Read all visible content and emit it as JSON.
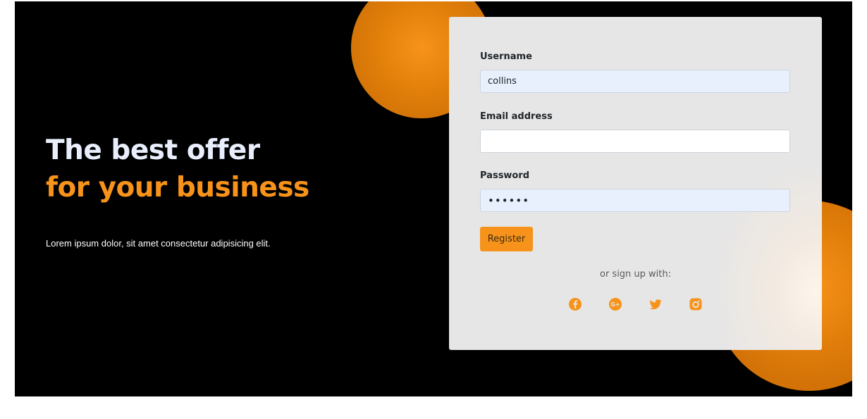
{
  "hero": {
    "headline_line1": "The best offer",
    "headline_line2": "for your business",
    "lede": "Lorem ipsum dolor, sit amet consectetur adipisicing elit."
  },
  "form": {
    "username": {
      "label": "Username",
      "value": "collins"
    },
    "email": {
      "label": "Email address",
      "value": ""
    },
    "password": {
      "label": "Password",
      "value": "••••••"
    },
    "register_label": "Register",
    "or_text": "or sign up with:",
    "socials": [
      {
        "name": "facebook-icon"
      },
      {
        "name": "google-plus-icon"
      },
      {
        "name": "twitter-icon"
      },
      {
        "name": "instagram-icon"
      }
    ]
  },
  "colors": {
    "accent": "#f7931a",
    "hero_bg": "#000000",
    "card_bg": "#e6e6e6",
    "filled_input_bg": "#e8f0fe"
  }
}
